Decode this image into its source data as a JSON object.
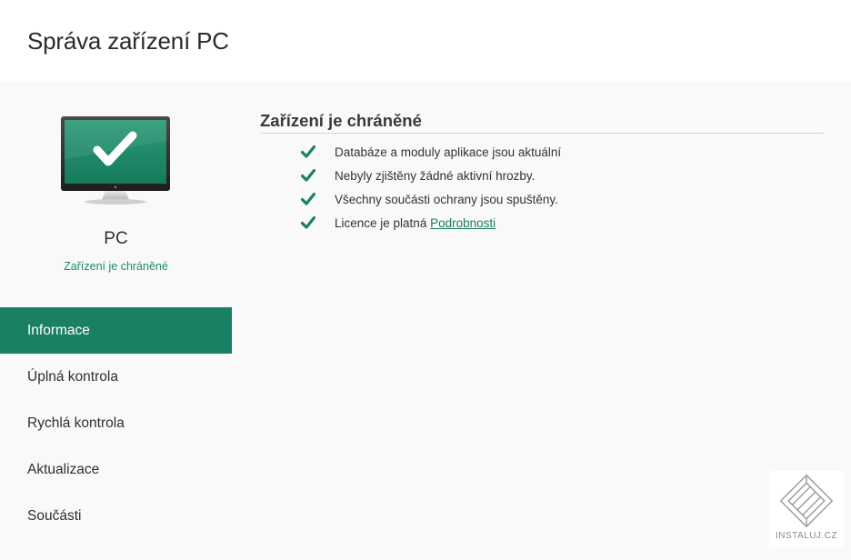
{
  "app": {
    "title": "Správa zařízení PC"
  },
  "device": {
    "icon": "monitor-check-icon",
    "name": "PC",
    "status": "Zařízení je chráněné"
  },
  "nav": {
    "items": [
      {
        "label": "Informace",
        "active": true
      },
      {
        "label": "Úplná kontrola",
        "active": false
      },
      {
        "label": "Rychlá kontrola",
        "active": false
      },
      {
        "label": "Aktualizace",
        "active": false
      },
      {
        "label": "Součásti",
        "active": false
      }
    ]
  },
  "main": {
    "section_title": "Zařízení je chráněné",
    "items": [
      {
        "icon": "check-icon",
        "text": "Databáze a moduly aplikace jsou aktuální"
      },
      {
        "icon": "check-icon",
        "text": "Nebyly zjištěny žádné aktivní hrozby."
      },
      {
        "icon": "check-icon",
        "text": "Všechny součásti ochrany jsou spuštěny."
      },
      {
        "icon": "check-icon",
        "text": "Licence je platná",
        "link": "Podrobnosti"
      }
    ]
  },
  "watermark": {
    "text": "INSTALUJ.CZ"
  },
  "colors": {
    "accent": "#1a8064",
    "accent_text": "#1f8a6a",
    "background": "#f9f9f9"
  }
}
